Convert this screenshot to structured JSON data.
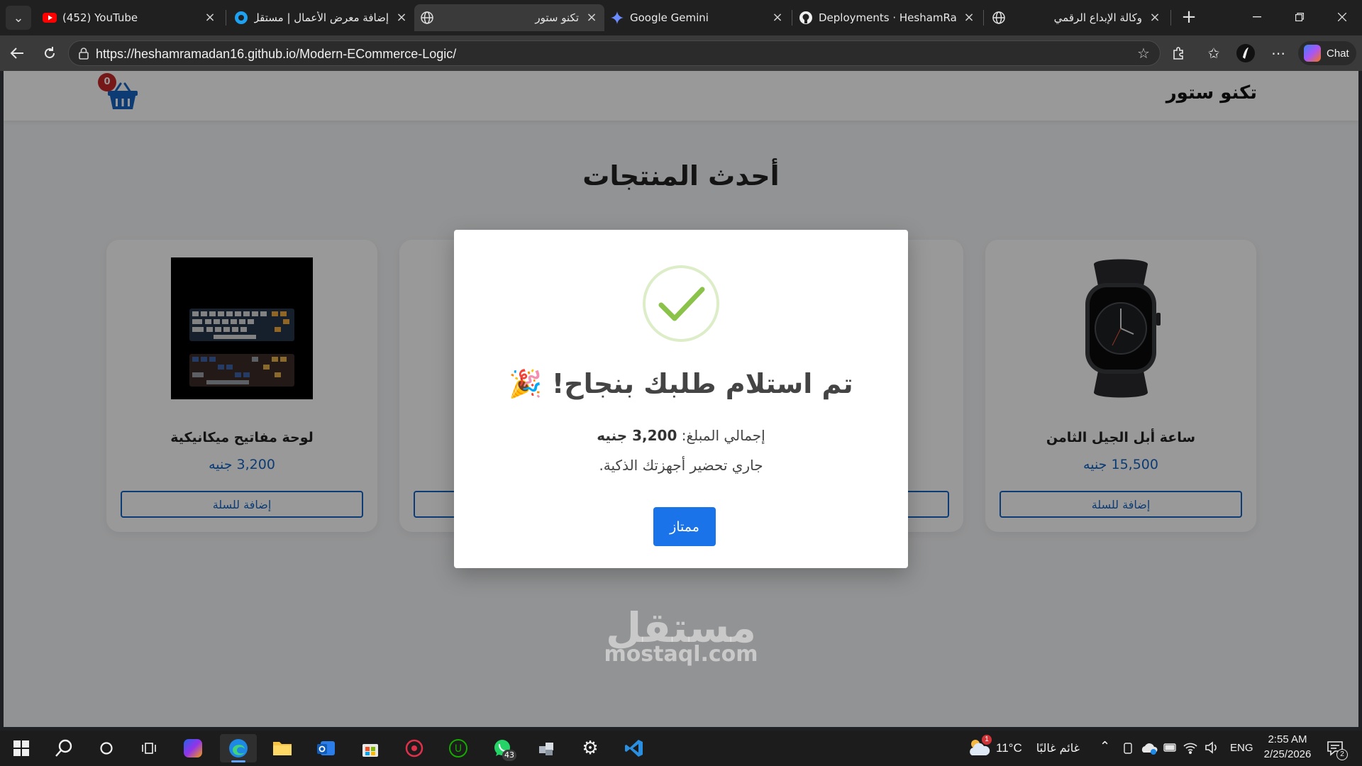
{
  "browser": {
    "tabs": [
      {
        "title": "(452) YouTube",
        "icon": "youtube-icon"
      },
      {
        "title": "إضافة معرض الأعمال | مستقل",
        "icon": "mostaql-icon"
      },
      {
        "title": "تكنو ستور",
        "icon": "globe-icon",
        "active": true
      },
      {
        "title": "Google Gemini",
        "icon": "gemini-icon"
      },
      {
        "title": "Deployments · HeshamRamadan",
        "icon": "github-icon"
      },
      {
        "title": "وكالة الإبداع الرقمي",
        "icon": "globe-icon"
      }
    ],
    "url": "https://heshamramadan16.github.io/Modern-ECommerce-Logic/",
    "chat_label": "Chat"
  },
  "site": {
    "brand": "تكنو ستور",
    "cart_count": "0",
    "section_title": "أحدث المنتجات",
    "add_label": "إضافة للسلة",
    "products": [
      {
        "name": "لوحة مفاتيح ميكانيكية",
        "price": "3,200 جنيه",
        "image": "mechanical-keyboard"
      },
      {
        "name": "",
        "price": "",
        "image": ""
      },
      {
        "name": "",
        "price": "",
        "image": ""
      },
      {
        "name": "ساعة أبل الجيل الثامن",
        "price": "15,500 جنيه",
        "image": "apple-watch"
      }
    ]
  },
  "modal": {
    "title": "تم استلام طلبك بنجاح! 🎉",
    "total_label": "إجمالي المبلغ:",
    "total_value": "3,200 جنيه",
    "message": "جاري تحضير أجهزتك الذكية.",
    "ok_label": "ممتاز"
  },
  "watermark": {
    "arabic": "مستقل",
    "latin": "mostaql.com"
  },
  "taskbar": {
    "weather_temp": "11°C",
    "weather_desc": "غائم غالبًا",
    "language": "ENG",
    "time": "2:55 AM",
    "date": "2/25/2026",
    "notification_count": "2",
    "whatsapp_badge": "43",
    "weather_alert": "1"
  },
  "colors": {
    "accent": "#1a73e8",
    "price": "#1565c0",
    "success": "#8bc34a",
    "cart_badge": "#c62828"
  }
}
